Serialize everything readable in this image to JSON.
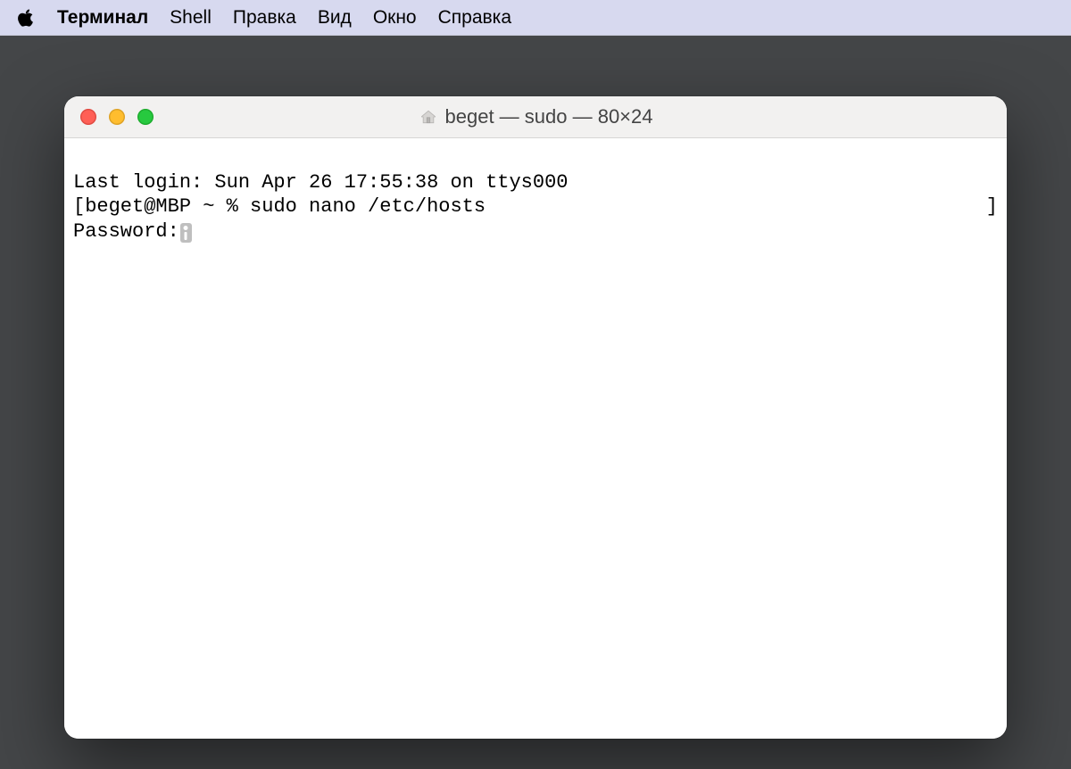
{
  "menubar": {
    "app": "Терминал",
    "items": [
      "Shell",
      "Правка",
      "Вид",
      "Окно",
      "Справка"
    ]
  },
  "window": {
    "title": "beget — sudo — 80×24"
  },
  "terminal": {
    "last_login": "Last login: Sun Apr 26 17:55:38 on ttys000",
    "prompt_open": "[",
    "prompt_text": "beget@MBP ~ % sudo nano /etc/hosts",
    "prompt_close": "]",
    "password_label": "Password:"
  }
}
